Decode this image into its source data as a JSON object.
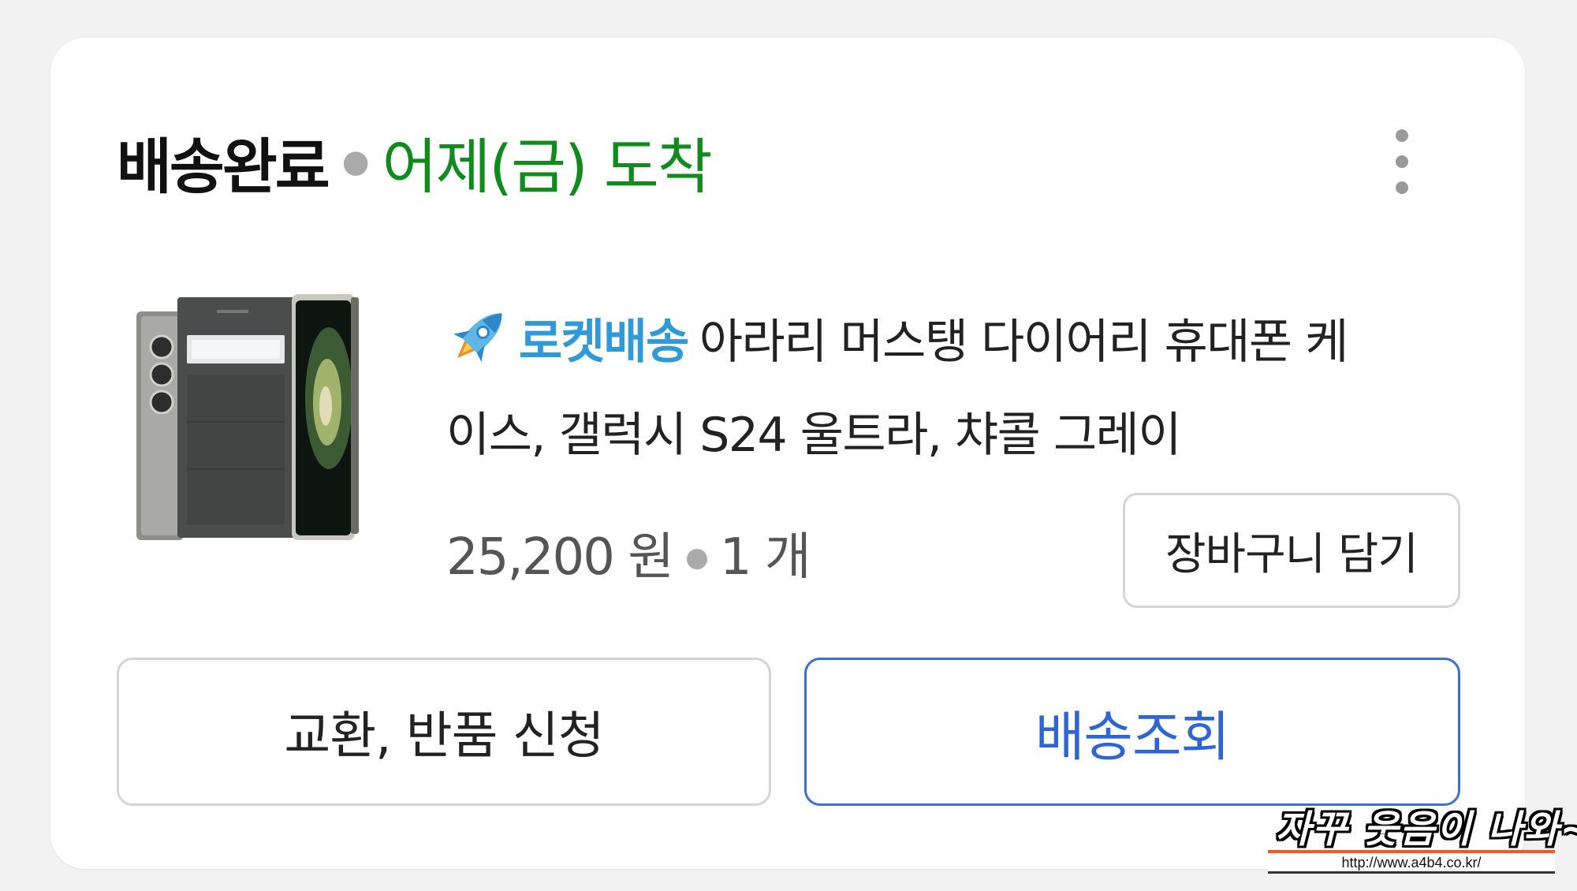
{
  "order": {
    "status": "배송완료",
    "arrival": "어제(금) 도착"
  },
  "product": {
    "badge": "로켓배송",
    "title_line1": "아라리 머스탱 다이어리 휴대폰 케",
    "title_line2": "이스, 갤럭시 S24 울트라, 챠콜 그레이",
    "price": "25,200 원",
    "quantity": "1 개",
    "image_alt": "phone case product image"
  },
  "actions": {
    "add_to_cart": "장바구니 담기",
    "exchange_return": "교환, 반품 신청",
    "track_delivery": "배송조회"
  },
  "icons": {
    "more": "more-vertical-icon",
    "rocket": "rocket-icon"
  },
  "colors": {
    "arrival": "#118a1e",
    "rocket_badge": "#2f9ad8",
    "track_button": "#2d64d6"
  },
  "watermark": {
    "text": "자꾸 웃음이 나와~",
    "url": "http://www.a4b4.co.kr/"
  }
}
